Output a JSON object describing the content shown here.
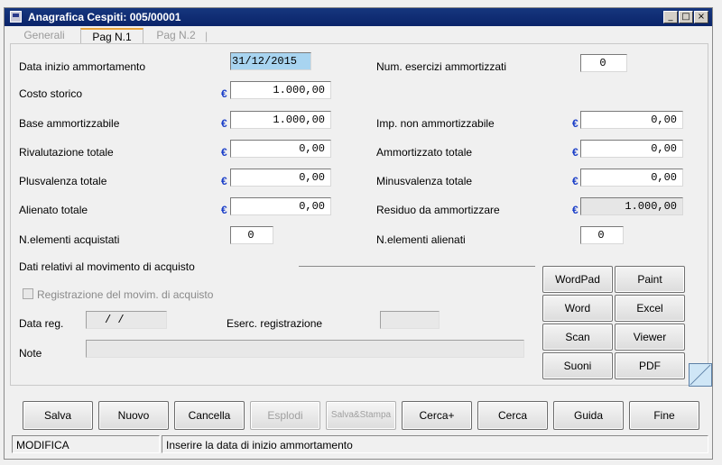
{
  "window": {
    "title": "Anagrafica Cespiti: 005/00001",
    "controls": {
      "minimize": "_",
      "maximize": "□",
      "close": "×"
    }
  },
  "tabs": [
    {
      "label": "Generali"
    },
    {
      "label": "Pag N.1"
    },
    {
      "label": "Pag N.2"
    }
  ],
  "tab_separator": "|",
  "currency_symbol": "€",
  "form": {
    "data_inizio_label": "Data inizio ammortamento",
    "data_inizio_value": "31/12/2015",
    "num_esercizi_label": "Num. esercizi ammortizzati",
    "num_esercizi_value": "0",
    "costo_storico_label": "Costo storico",
    "costo_storico_value": "1.000,00",
    "base_label": "Base ammortizzabile",
    "base_value": "1.000,00",
    "imp_non_label": "Imp. non ammortizzabile",
    "imp_non_value": "0,00",
    "rivalutazione_label": "Rivalutazione totale",
    "rivalutazione_value": "0,00",
    "ammortizzato_label": "Ammortizzato totale",
    "ammortizzato_value": "0,00",
    "plusvalenza_label": "Plusvalenza totale",
    "plusvalenza_value": "0,00",
    "minusvalenza_label": "Minusvalenza totale",
    "minusvalenza_value": "0,00",
    "alienato_label": "Alienato totale",
    "alienato_value": "0,00",
    "residuo_label": "Residuo da ammortizzare",
    "residuo_value": "1.000,00",
    "elem_acquistati_label": "N.elementi acquistati",
    "elem_acquistati_value": "0",
    "elem_alienati_label": "N.elementi alienati",
    "elem_alienati_value": "0",
    "movimento_section_label": "Dati relativi al movimento di acquisto",
    "registrazione_checkbox_label": "Registrazione del movim. di acquisto",
    "data_reg_label": "Data reg.",
    "data_reg_value": " /  /",
    "eserc_label": "Eserc. registrazione",
    "eserc_value": "",
    "note_label": "Note",
    "note_value": ""
  },
  "side_buttons": [
    "WordPad",
    "Paint",
    "Word",
    "Excel",
    "Scan",
    "Viewer",
    "Suoni",
    "PDF"
  ],
  "bottom_buttons": [
    {
      "label": "Salva",
      "enabled": true
    },
    {
      "label": "Nuovo",
      "enabled": true
    },
    {
      "label": "Cancella",
      "enabled": true
    },
    {
      "label": "Esplodi",
      "enabled": false
    },
    {
      "label": "Salva&Stampa",
      "enabled": false
    },
    {
      "label": "Cerca+",
      "enabled": true
    },
    {
      "label": "Cerca",
      "enabled": true
    },
    {
      "label": "Guida",
      "enabled": true
    },
    {
      "label": "Fine",
      "enabled": true
    }
  ],
  "status": {
    "mode": "MODIFICA",
    "message": "Inserire la data di inizio ammortamento"
  },
  "colors": {
    "titlebar": "#0a246a",
    "selected_field": "#a8d4f0",
    "currency": "#1a3ec8",
    "active_tab_accent": "#e8a33a"
  }
}
